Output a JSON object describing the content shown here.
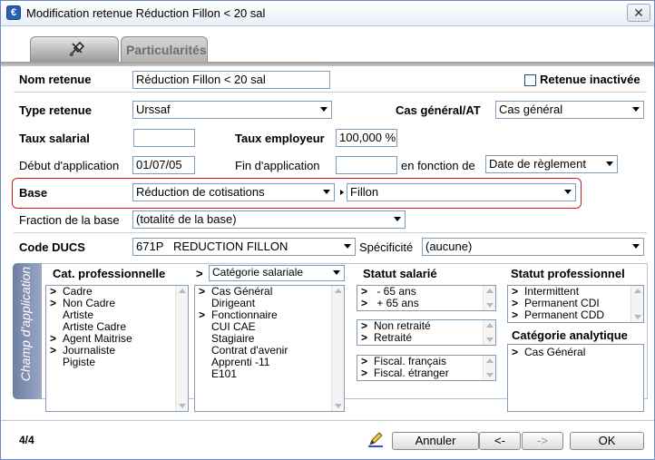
{
  "window": {
    "title": "Modification retenue Réduction Fillon < 20 sal",
    "close_glyph": "✕",
    "app_icon_glyph": "€"
  },
  "tabs": [
    {
      "icon": "settings-icon"
    },
    {
      "label": "Particularités"
    }
  ],
  "form": {
    "nom_retenue_label": "Nom retenue",
    "nom_retenue_value": "Réduction Fillon < 20 sal",
    "retenue_inactivee_label": "Retenue inactivée",
    "type_retenue_label": "Type retenue",
    "type_retenue_value": "Urssaf",
    "cas_general_label": "Cas général/AT",
    "cas_general_value": "Cas général",
    "taux_salarial_label": "Taux salarial",
    "taux_salarial_value": "",
    "taux_employeur_label": "Taux employeur",
    "taux_employeur_value": "100,000 %",
    "debut_application_label": "Début d'application",
    "debut_application_value": "01/07/05",
    "fin_application_label": "Fin d'application",
    "fin_application_value": "",
    "en_fonction_label": "en fonction de",
    "en_fonction_value": "Date de règlement",
    "base_label": "Base",
    "base_value": "Réduction de cotisations",
    "base_sub_value": "Fillon",
    "fraction_label": "Fraction de la base",
    "fraction_value": "(totalité de la base)",
    "code_ducs_label": "Code DUCS",
    "code_ducs_value": "671P   REDUCTION FILLON",
    "specificite_label": "Spécificité",
    "specificite_value": "(aucune)"
  },
  "scope": {
    "band_label": "Champ d'application",
    "cat_pro": {
      "header": "Cat. professionnelle",
      "items": [
        {
          "mark": ">",
          "label": "Cadre"
        },
        {
          "mark": ">",
          "label": "Non Cadre"
        },
        {
          "mark": "",
          "label": "Artiste"
        },
        {
          "mark": "",
          "label": "Artiste Cadre"
        },
        {
          "mark": ">",
          "label": "Agent Maitrise"
        },
        {
          "mark": ">",
          "label": "Journaliste"
        },
        {
          "mark": "",
          "label": "Pigiste"
        }
      ]
    },
    "cat_sal": {
      "header_prefix": ">",
      "header_value": "Catégorie salariale",
      "items": [
        {
          "mark": ">",
          "label": "Cas Général"
        },
        {
          "mark": "",
          "label": "Dirigeant"
        },
        {
          "mark": ">",
          "label": "Fonctionnaire"
        },
        {
          "mark": "",
          "label": "CUI CAE"
        },
        {
          "mark": "",
          "label": "Stagiaire"
        },
        {
          "mark": "",
          "label": "Contrat d'avenir"
        },
        {
          "mark": "",
          "label": "Apprenti -11"
        },
        {
          "mark": "",
          "label": "E101"
        }
      ]
    },
    "statut_salarie": {
      "header": "Statut salarié",
      "age": [
        {
          "mark": ">",
          "label": " - 65 ans"
        },
        {
          "mark": ">",
          "label": " + 65 ans"
        }
      ],
      "retraite": [
        {
          "mark": ">",
          "label": "Non retraité"
        },
        {
          "mark": ">",
          "label": "Retraité"
        }
      ],
      "fiscal": [
        {
          "mark": ">",
          "label": "Fiscal. français"
        },
        {
          "mark": ">",
          "label": "Fiscal. étranger"
        }
      ]
    },
    "statut_pro": {
      "header": "Statut professionnel",
      "items": [
        {
          "mark": ">",
          "label": "Intermittent"
        },
        {
          "mark": ">",
          "label": "Permanent CDI"
        },
        {
          "mark": ">",
          "label": "Permanent CDD"
        }
      ]
    },
    "cat_analytique": {
      "header": "Catégorie analytique",
      "items": [
        {
          "mark": ">",
          "label": "Cas Général"
        }
      ]
    }
  },
  "footer": {
    "page_counter": "4/4",
    "annuler_label": "Annuler",
    "prev_label": "<-",
    "next_label": "->",
    "ok_label": "OK"
  },
  "colors": {
    "highlight": "#d8191f",
    "scope_band": "#7f8eb0",
    "title_bar": "#e9eef7"
  }
}
